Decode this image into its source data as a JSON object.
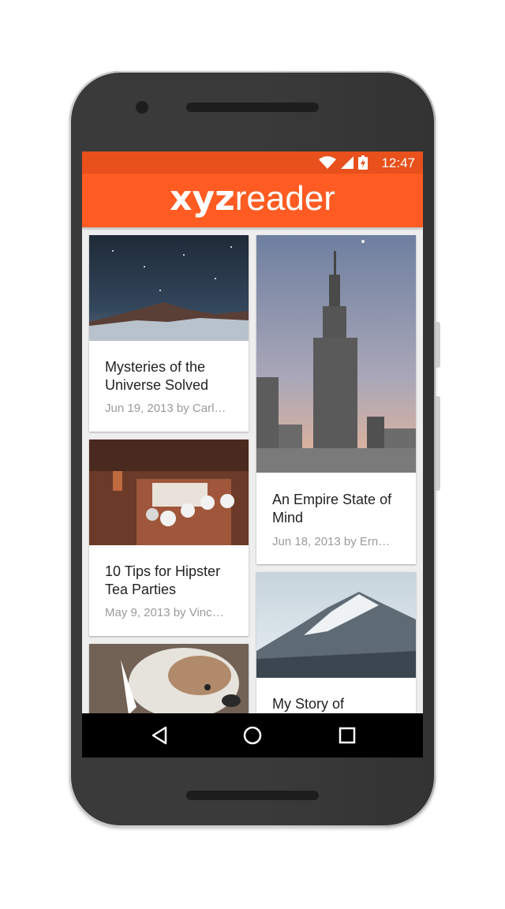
{
  "status": {
    "time": "12:47"
  },
  "app": {
    "logo_bold": "xyz",
    "logo_thin": "reader"
  },
  "articles": [
    {
      "title": "Mysteries of the Universe Solved",
      "meta": "Jun 19, 2013 by Carl…"
    },
    {
      "title": "An Empire State of Mind",
      "meta": "Jun 18, 2013 by Ern…"
    },
    {
      "title": "10 Tips for Hipster Tea Parties",
      "meta": "May 9, 2013 by Vinc…"
    },
    {
      "title": "My Story of",
      "meta": ""
    }
  ],
  "colors": {
    "accent": "#ff5b22",
    "statusbar": "#e8501c"
  },
  "icons": [
    "wifi-icon",
    "signal-icon",
    "battery-charging-icon",
    "back-icon",
    "home-icon",
    "recents-icon"
  ]
}
